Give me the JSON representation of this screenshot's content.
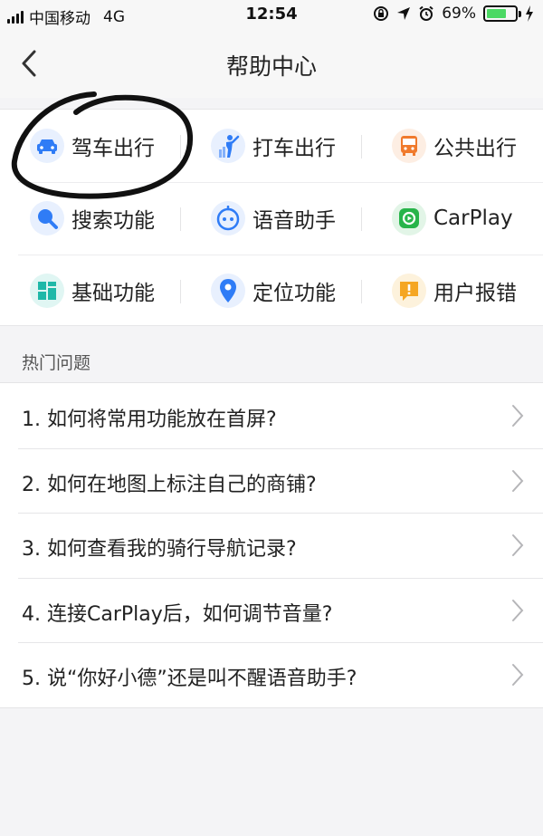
{
  "status_bar": {
    "carrier": "中国移动",
    "network": "4G",
    "time": "12:54",
    "battery_percent": "69%",
    "battery_level": 0.69,
    "icons": [
      "signal-icon",
      "rotation-lock-icon",
      "location-arrow-icon",
      "alarm-icon",
      "battery-icon",
      "charging-icon"
    ]
  },
  "nav": {
    "title": "帮助中心",
    "back_icon": "chevron-left-icon"
  },
  "categories": [
    {
      "label": "驾车出行",
      "icon": "car-icon",
      "color": "#2f7cf6"
    },
    {
      "label": "打车出行",
      "icon": "taxi-person-icon",
      "color": "#2f7cf6"
    },
    {
      "label": "公共出行",
      "icon": "bus-icon",
      "color": "#f07a2c"
    },
    {
      "label": "搜索功能",
      "icon": "search-icon",
      "color": "#2f7cf6"
    },
    {
      "label": "语音助手",
      "icon": "voice-assistant-icon",
      "color": "#2f7cf6"
    },
    {
      "label": "CarPlay",
      "icon": "carplay-icon",
      "color": "#27b44a"
    },
    {
      "label": "基础功能",
      "icon": "basic-functions-icon",
      "color": "#1fb8a8"
    },
    {
      "label": "定位功能",
      "icon": "location-pin-icon",
      "color": "#2f7cf6"
    },
    {
      "label": "用户报错",
      "icon": "report-error-icon",
      "color": "#f5a623"
    }
  ],
  "faq_section": {
    "title": "热门问题",
    "items": [
      "1. 如何将常用功能放在首屏?",
      "2. 如何在地图上标注自己的商铺?",
      "3. 如何查看我的骑行导航记录?",
      "4. 连接CarPlay后，如何调节音量?",
      "5. 说“你好小德”还是叫不醒语音助手?"
    ]
  }
}
